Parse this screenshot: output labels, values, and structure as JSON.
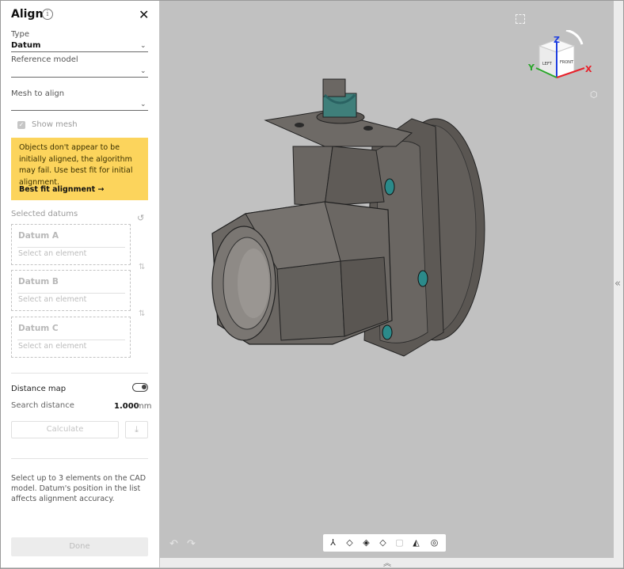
{
  "panel": {
    "title": "Align",
    "type_label": "Type",
    "type_value": "Datum",
    "reference_label": "Reference model",
    "mesh_label": "Mesh to align",
    "show_mesh_label": "Show mesh",
    "warning_text": "Objects don't appear to be initially aligned, the algorithm may fail. Use best fit for initial alignment.",
    "warning_link": "Best fit alignment",
    "selected_datums_label": "Selected datums",
    "datums": [
      {
        "title": "Datum A",
        "hint": "Select an element"
      },
      {
        "title": "Datum B",
        "hint": "Select an element"
      },
      {
        "title": "Datum C",
        "hint": "Select an element"
      }
    ],
    "distance_map_label": "Distance map",
    "search_distance_label": "Search distance",
    "search_distance_value": "1.000",
    "search_distance_unit": "mm",
    "calculate_label": "Calculate",
    "help_text": "Select up to 3 elements on the CAD model. Datum's position in the list affects alignment accuracy.",
    "done_label": "Done"
  },
  "navcube": {
    "z_label": "Z",
    "y_label": "Y",
    "x_label": "X",
    "left_face": "LEFT",
    "front_face": "FRONT"
  },
  "toolbar_icons": [
    "axes-icon",
    "view-iso-icon",
    "view-front-icon",
    "view-side-icon",
    "view-transparent-icon",
    "view-section-icon",
    "target-icon"
  ],
  "colors": {
    "warning_bg": "#fcd45c",
    "viewport_bg": "#c1c1c1",
    "axis_x": "#e8202a",
    "axis_y": "#2aa52a",
    "axis_z": "#2040e0"
  }
}
